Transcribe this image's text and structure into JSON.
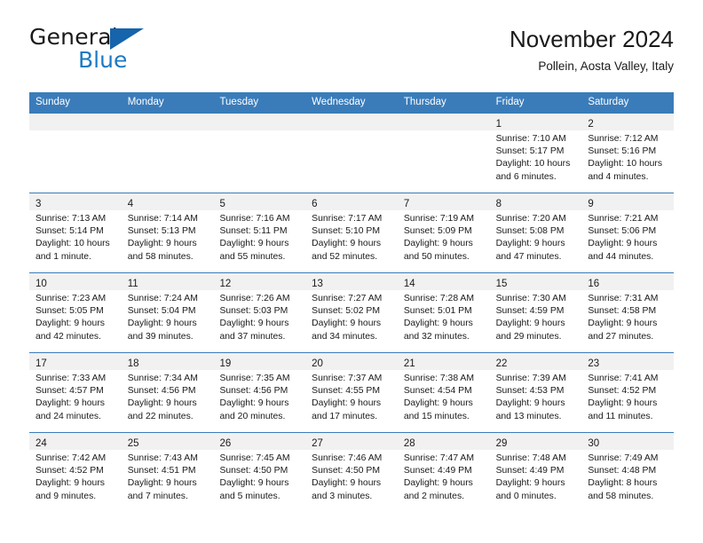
{
  "brand": {
    "name_part1": "General",
    "name_part2": "Blue",
    "accent_color": "#1b7ac4",
    "flag_color": "#1664ab"
  },
  "header": {
    "title": "November 2024",
    "location": "Pollein, Aosta Valley, Italy"
  },
  "calendar": {
    "header_bg": "#3a7cba",
    "daynum_bg": "#f1f1f1",
    "weekdays": [
      "Sunday",
      "Monday",
      "Tuesday",
      "Wednesday",
      "Thursday",
      "Friday",
      "Saturday"
    ],
    "weeks": [
      [
        {
          "day": "",
          "sunrise": "",
          "sunset": "",
          "daylight1": "",
          "daylight2": ""
        },
        {
          "day": "",
          "sunrise": "",
          "sunset": "",
          "daylight1": "",
          "daylight2": ""
        },
        {
          "day": "",
          "sunrise": "",
          "sunset": "",
          "daylight1": "",
          "daylight2": ""
        },
        {
          "day": "",
          "sunrise": "",
          "sunset": "",
          "daylight1": "",
          "daylight2": ""
        },
        {
          "day": "",
          "sunrise": "",
          "sunset": "",
          "daylight1": "",
          "daylight2": ""
        },
        {
          "day": "1",
          "sunrise": "Sunrise: 7:10 AM",
          "sunset": "Sunset: 5:17 PM",
          "daylight1": "Daylight: 10 hours",
          "daylight2": "and 6 minutes."
        },
        {
          "day": "2",
          "sunrise": "Sunrise: 7:12 AM",
          "sunset": "Sunset: 5:16 PM",
          "daylight1": "Daylight: 10 hours",
          "daylight2": "and 4 minutes."
        }
      ],
      [
        {
          "day": "3",
          "sunrise": "Sunrise: 7:13 AM",
          "sunset": "Sunset: 5:14 PM",
          "daylight1": "Daylight: 10 hours",
          "daylight2": "and 1 minute."
        },
        {
          "day": "4",
          "sunrise": "Sunrise: 7:14 AM",
          "sunset": "Sunset: 5:13 PM",
          "daylight1": "Daylight: 9 hours",
          "daylight2": "and 58 minutes."
        },
        {
          "day": "5",
          "sunrise": "Sunrise: 7:16 AM",
          "sunset": "Sunset: 5:11 PM",
          "daylight1": "Daylight: 9 hours",
          "daylight2": "and 55 minutes."
        },
        {
          "day": "6",
          "sunrise": "Sunrise: 7:17 AM",
          "sunset": "Sunset: 5:10 PM",
          "daylight1": "Daylight: 9 hours",
          "daylight2": "and 52 minutes."
        },
        {
          "day": "7",
          "sunrise": "Sunrise: 7:19 AM",
          "sunset": "Sunset: 5:09 PM",
          "daylight1": "Daylight: 9 hours",
          "daylight2": "and 50 minutes."
        },
        {
          "day": "8",
          "sunrise": "Sunrise: 7:20 AM",
          "sunset": "Sunset: 5:08 PM",
          "daylight1": "Daylight: 9 hours",
          "daylight2": "and 47 minutes."
        },
        {
          "day": "9",
          "sunrise": "Sunrise: 7:21 AM",
          "sunset": "Sunset: 5:06 PM",
          "daylight1": "Daylight: 9 hours",
          "daylight2": "and 44 minutes."
        }
      ],
      [
        {
          "day": "10",
          "sunrise": "Sunrise: 7:23 AM",
          "sunset": "Sunset: 5:05 PM",
          "daylight1": "Daylight: 9 hours",
          "daylight2": "and 42 minutes."
        },
        {
          "day": "11",
          "sunrise": "Sunrise: 7:24 AM",
          "sunset": "Sunset: 5:04 PM",
          "daylight1": "Daylight: 9 hours",
          "daylight2": "and 39 minutes."
        },
        {
          "day": "12",
          "sunrise": "Sunrise: 7:26 AM",
          "sunset": "Sunset: 5:03 PM",
          "daylight1": "Daylight: 9 hours",
          "daylight2": "and 37 minutes."
        },
        {
          "day": "13",
          "sunrise": "Sunrise: 7:27 AM",
          "sunset": "Sunset: 5:02 PM",
          "daylight1": "Daylight: 9 hours",
          "daylight2": "and 34 minutes."
        },
        {
          "day": "14",
          "sunrise": "Sunrise: 7:28 AM",
          "sunset": "Sunset: 5:01 PM",
          "daylight1": "Daylight: 9 hours",
          "daylight2": "and 32 minutes."
        },
        {
          "day": "15",
          "sunrise": "Sunrise: 7:30 AM",
          "sunset": "Sunset: 4:59 PM",
          "daylight1": "Daylight: 9 hours",
          "daylight2": "and 29 minutes."
        },
        {
          "day": "16",
          "sunrise": "Sunrise: 7:31 AM",
          "sunset": "Sunset: 4:58 PM",
          "daylight1": "Daylight: 9 hours",
          "daylight2": "and 27 minutes."
        }
      ],
      [
        {
          "day": "17",
          "sunrise": "Sunrise: 7:33 AM",
          "sunset": "Sunset: 4:57 PM",
          "daylight1": "Daylight: 9 hours",
          "daylight2": "and 24 minutes."
        },
        {
          "day": "18",
          "sunrise": "Sunrise: 7:34 AM",
          "sunset": "Sunset: 4:56 PM",
          "daylight1": "Daylight: 9 hours",
          "daylight2": "and 22 minutes."
        },
        {
          "day": "19",
          "sunrise": "Sunrise: 7:35 AM",
          "sunset": "Sunset: 4:56 PM",
          "daylight1": "Daylight: 9 hours",
          "daylight2": "and 20 minutes."
        },
        {
          "day": "20",
          "sunrise": "Sunrise: 7:37 AM",
          "sunset": "Sunset: 4:55 PM",
          "daylight1": "Daylight: 9 hours",
          "daylight2": "and 17 minutes."
        },
        {
          "day": "21",
          "sunrise": "Sunrise: 7:38 AM",
          "sunset": "Sunset: 4:54 PM",
          "daylight1": "Daylight: 9 hours",
          "daylight2": "and 15 minutes."
        },
        {
          "day": "22",
          "sunrise": "Sunrise: 7:39 AM",
          "sunset": "Sunset: 4:53 PM",
          "daylight1": "Daylight: 9 hours",
          "daylight2": "and 13 minutes."
        },
        {
          "day": "23",
          "sunrise": "Sunrise: 7:41 AM",
          "sunset": "Sunset: 4:52 PM",
          "daylight1": "Daylight: 9 hours",
          "daylight2": "and 11 minutes."
        }
      ],
      [
        {
          "day": "24",
          "sunrise": "Sunrise: 7:42 AM",
          "sunset": "Sunset: 4:52 PM",
          "daylight1": "Daylight: 9 hours",
          "daylight2": "and 9 minutes."
        },
        {
          "day": "25",
          "sunrise": "Sunrise: 7:43 AM",
          "sunset": "Sunset: 4:51 PM",
          "daylight1": "Daylight: 9 hours",
          "daylight2": "and 7 minutes."
        },
        {
          "day": "26",
          "sunrise": "Sunrise: 7:45 AM",
          "sunset": "Sunset: 4:50 PM",
          "daylight1": "Daylight: 9 hours",
          "daylight2": "and 5 minutes."
        },
        {
          "day": "27",
          "sunrise": "Sunrise: 7:46 AM",
          "sunset": "Sunset: 4:50 PM",
          "daylight1": "Daylight: 9 hours",
          "daylight2": "and 3 minutes."
        },
        {
          "day": "28",
          "sunrise": "Sunrise: 7:47 AM",
          "sunset": "Sunset: 4:49 PM",
          "daylight1": "Daylight: 9 hours",
          "daylight2": "and 2 minutes."
        },
        {
          "day": "29",
          "sunrise": "Sunrise: 7:48 AM",
          "sunset": "Sunset: 4:49 PM",
          "daylight1": "Daylight: 9 hours",
          "daylight2": "and 0 minutes."
        },
        {
          "day": "30",
          "sunrise": "Sunrise: 7:49 AM",
          "sunset": "Sunset: 4:48 PM",
          "daylight1": "Daylight: 8 hours",
          "daylight2": "and 58 minutes."
        }
      ]
    ]
  }
}
